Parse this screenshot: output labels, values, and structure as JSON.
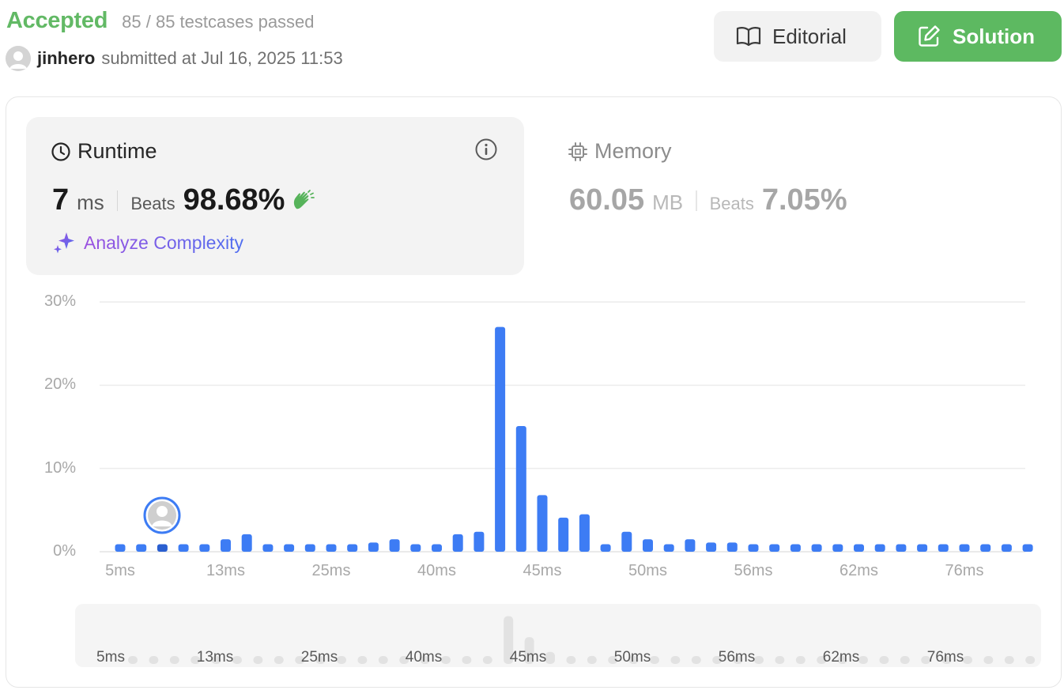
{
  "header": {
    "status": "Accepted",
    "testcases": "85 / 85 testcases passed",
    "username": "jinhero",
    "submitted": "submitted at Jul 16, 2025 11:53"
  },
  "buttons": {
    "editorial": "Editorial",
    "solution": "Solution"
  },
  "runtime": {
    "title": "Runtime",
    "value": "7",
    "unit": "ms",
    "beats_label": "Beats",
    "beats": "98.68%",
    "analyze": "Analyze Complexity"
  },
  "memory": {
    "title": "Memory",
    "value": "60.05",
    "unit": "MB",
    "beats_label": "Beats",
    "beats": "7.05%"
  },
  "colors": {
    "accepted": "#62b965",
    "bar": "#3d7cf4",
    "bar_selected": "#2a5fd0",
    "solution_button": "#5db961"
  },
  "chart_data": {
    "type": "bar",
    "title": "",
    "xlabel": "",
    "ylabel": "",
    "ylim": [
      0,
      30
    ],
    "y_ticks": [
      "30%",
      "20%",
      "10%",
      "0%"
    ],
    "x_tick_labels": [
      "5ms",
      "13ms",
      "25ms",
      "40ms",
      "45ms",
      "50ms",
      "56ms",
      "62ms",
      "76ms"
    ],
    "x_tick_bar_index": [
      0,
      5,
      10,
      15,
      20,
      25,
      30,
      35,
      40
    ],
    "user_bar_index": 2,
    "values": [
      0.9,
      0.9,
      0.9,
      0.9,
      0.9,
      1.5,
      2.1,
      0.9,
      0.9,
      0.9,
      0.9,
      0.9,
      1.1,
      1.5,
      0.9,
      0.9,
      2.1,
      2.4,
      27.0,
      15.1,
      6.8,
      4.1,
      4.5,
      0.9,
      2.4,
      1.5,
      0.9,
      1.5,
      1.1,
      1.1,
      0.9,
      0.9,
      0.9,
      0.9,
      0.9,
      0.9,
      0.9,
      0.9,
      0.9,
      0.9,
      0.9,
      0.9,
      0.9,
      0.9
    ]
  }
}
